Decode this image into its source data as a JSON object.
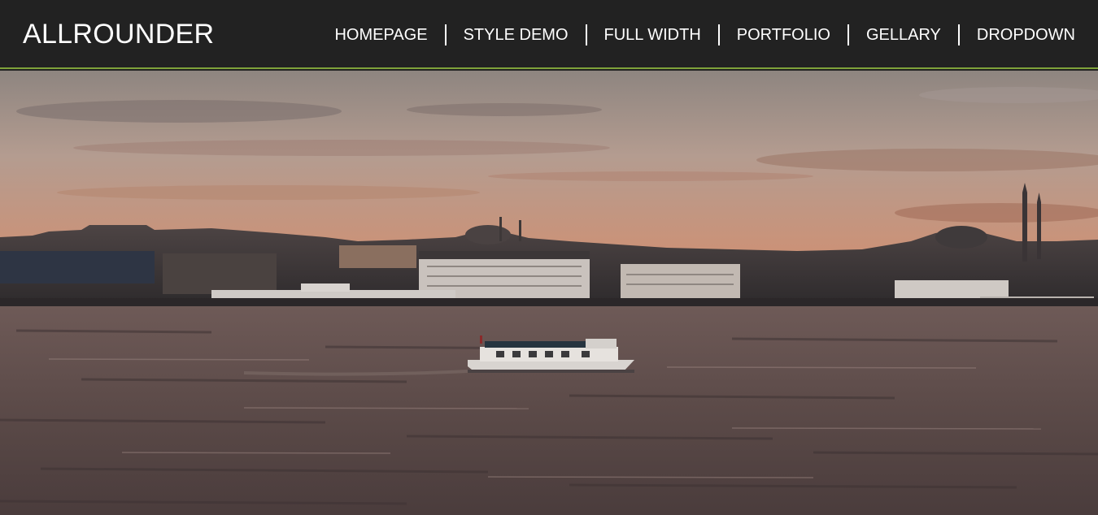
{
  "header": {
    "brand": "ALLROUNDER",
    "accent_color": "#7fa23a",
    "background": "#222222"
  },
  "nav": {
    "items": [
      {
        "label": "HOMEPAGE"
      },
      {
        "label": "STYLE DEMO"
      },
      {
        "label": "FULL WIDTH"
      },
      {
        "label": "PORTFOLIO"
      },
      {
        "label": "GELLARY"
      },
      {
        "label": "DROPDOWN"
      }
    ]
  },
  "hero": {
    "image_subject": "sunset-city-skyline-over-water-with-boat",
    "sky_colors": [
      "#8a7f78",
      "#c09a86",
      "#cf8c6e"
    ],
    "water_color": "#574948"
  }
}
